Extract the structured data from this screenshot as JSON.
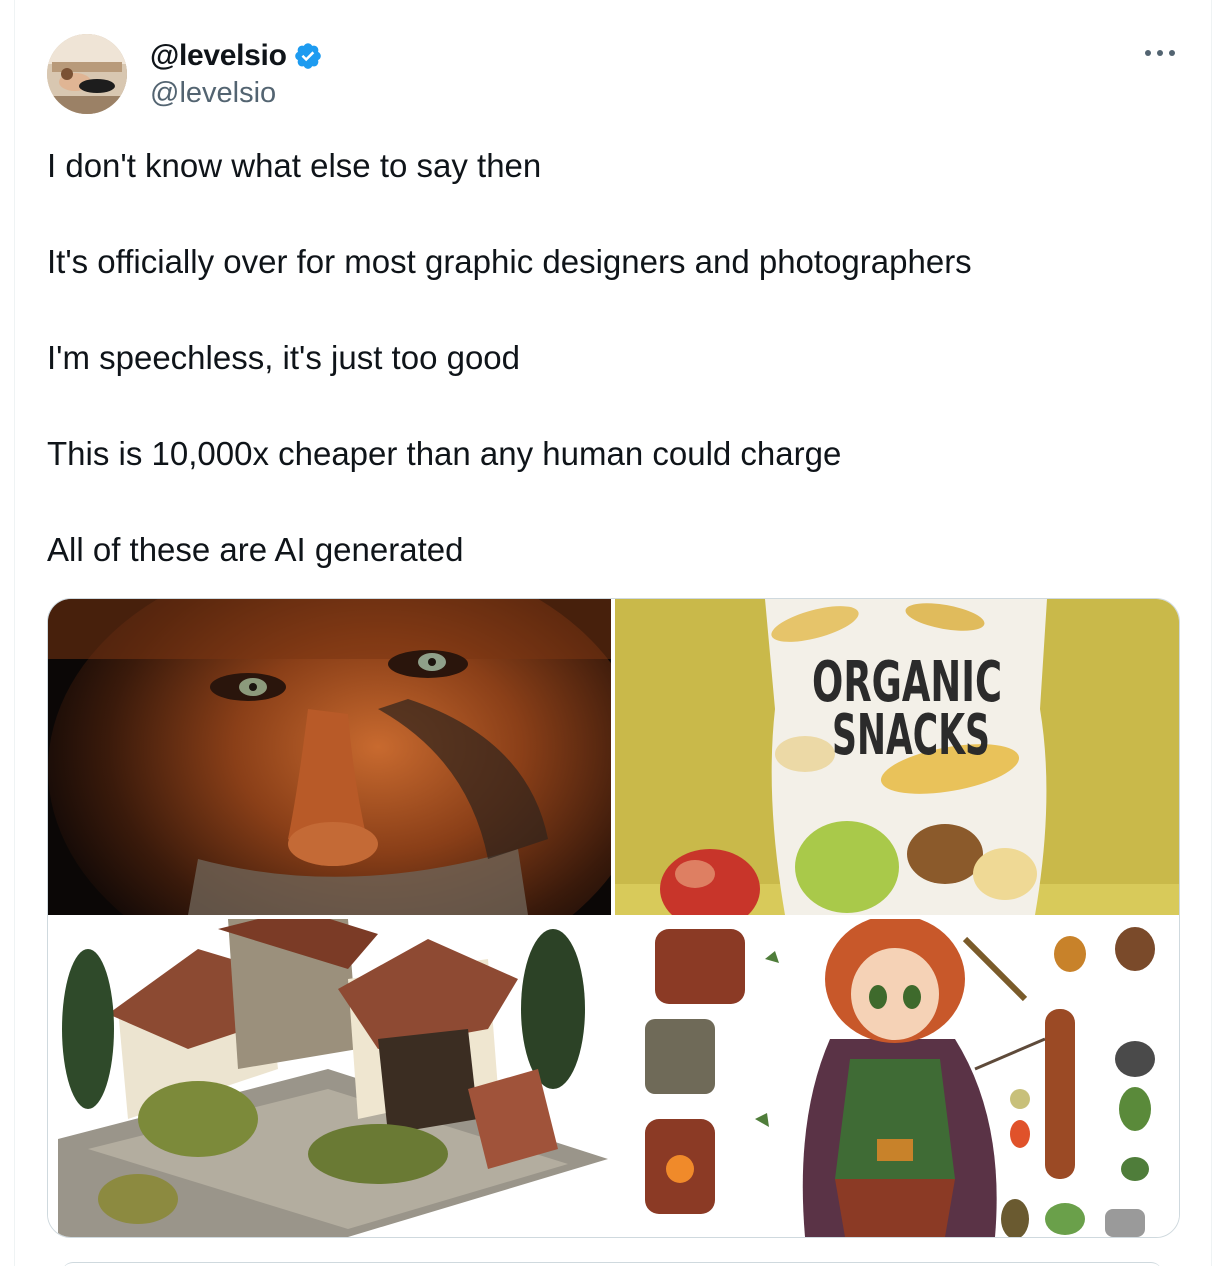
{
  "author": {
    "display_name": "@levelsio",
    "handle": "@levelsio",
    "verified": true,
    "verified_color": "#1d9bf0"
  },
  "menu": {
    "icon": "more-horizontal-icon"
  },
  "tweet": {
    "paragraphs": [
      "I don't know what else to say then",
      "It's officially over for most graphic designers and photographers",
      "I'm speechless, it's just too good",
      "This is 10,000x cheaper than any human could charge",
      "All of these are AI generated"
    ]
  },
  "media": {
    "images": [
      {
        "subject": "old-man-portrait"
      },
      {
        "subject": "organic-snacks-bag",
        "package_text_line1": "ORGANIC",
        "package_text_line2": "SNACKS"
      },
      {
        "subject": "isometric-medieval-house"
      },
      {
        "subject": "elf-archer-game-sprites"
      }
    ]
  },
  "colors": {
    "text_primary": "#0f1419",
    "text_secondary": "#536471",
    "border": "#cfd9de"
  }
}
